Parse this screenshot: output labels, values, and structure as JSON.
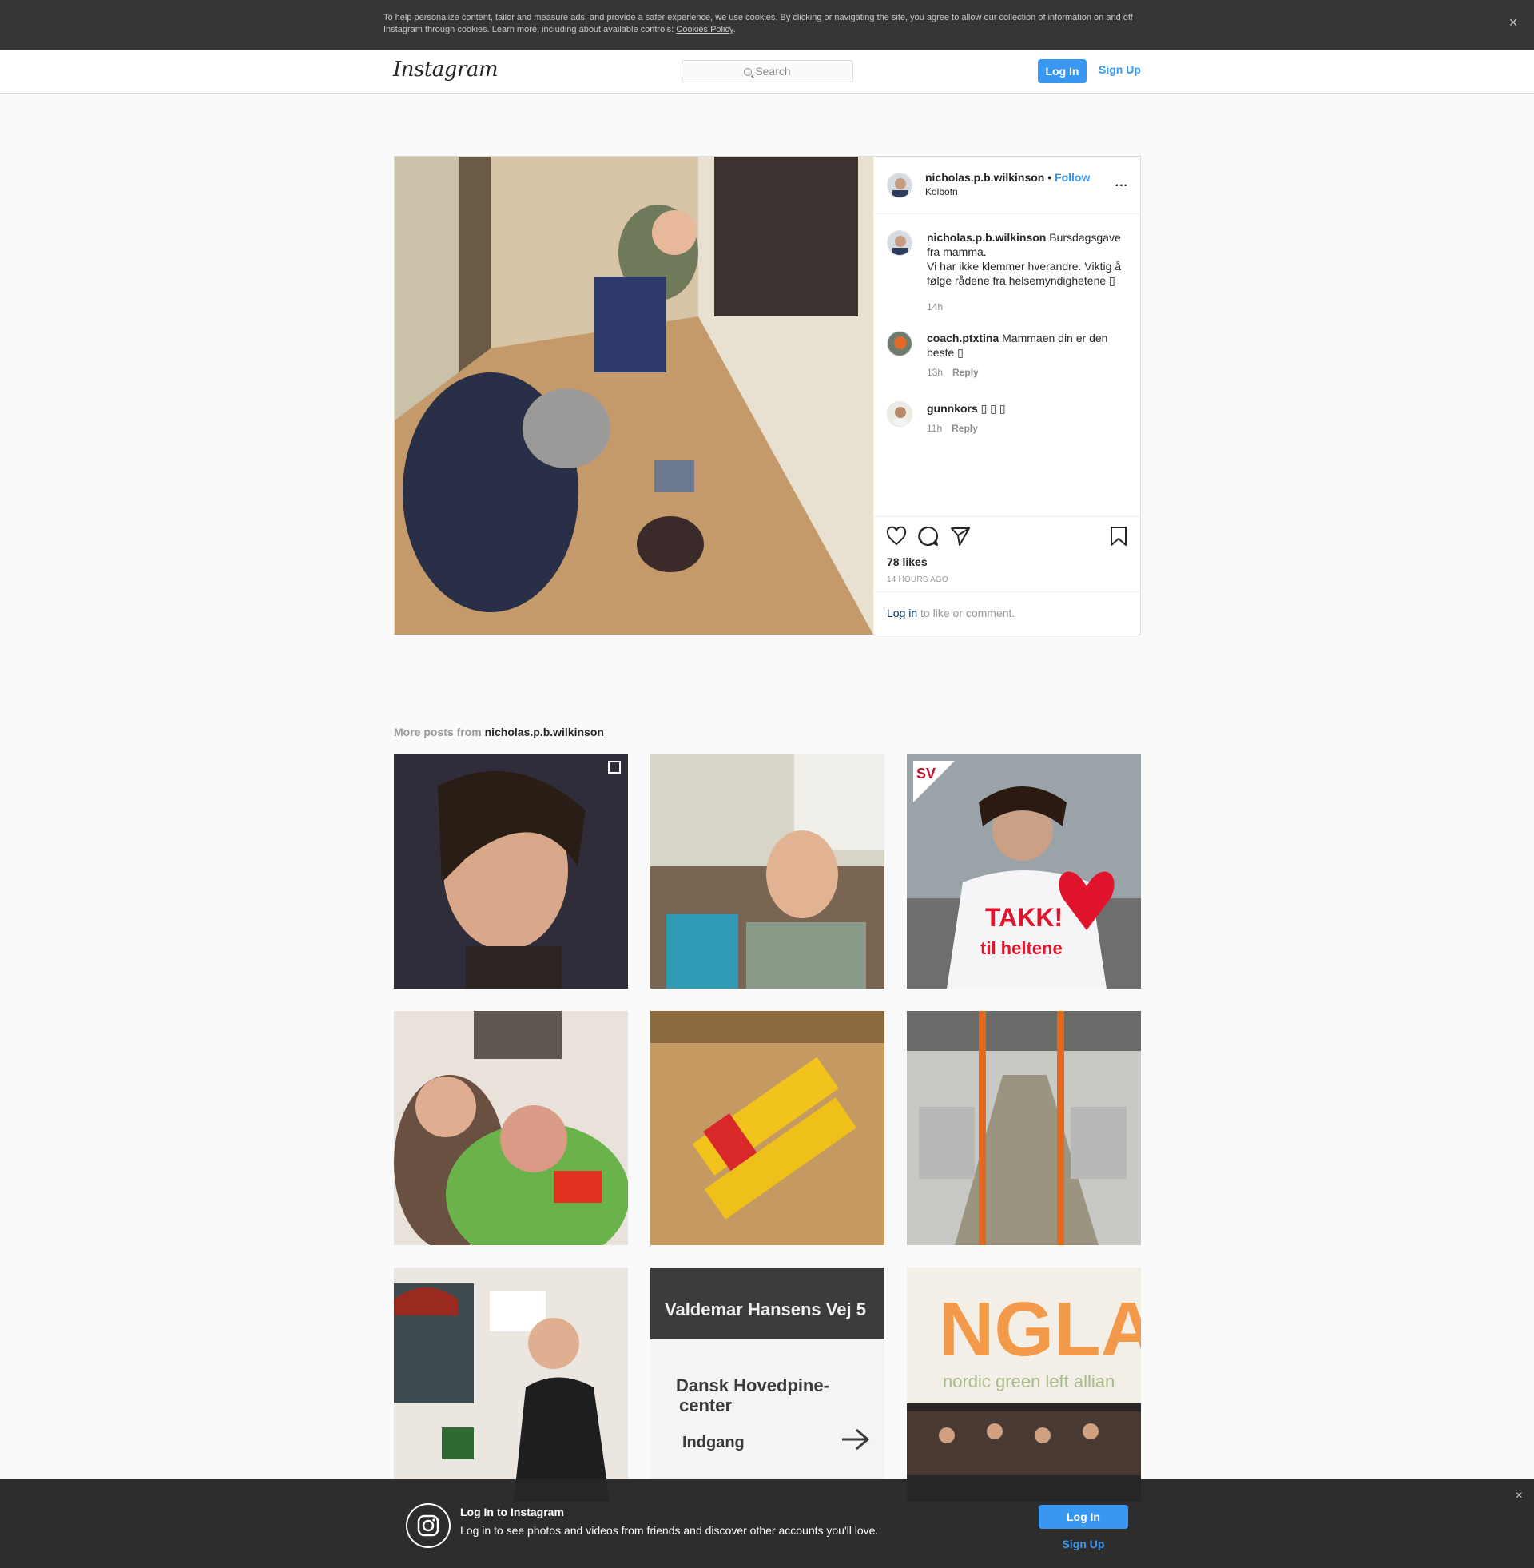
{
  "cookie_banner": {
    "text": "To help personalize content, tailor and measure ads, and provide a safer experience, we use cookies. By clicking or navigating the site, you agree to allow our collection of information on and off Instagram through cookies. Learn more, including about available controls: ",
    "link": "Cookies Policy",
    "end": ".",
    "close": "×"
  },
  "header": {
    "logo": "Instagram",
    "search_placeholder": "Search",
    "login": "Log In",
    "signup": "Sign Up"
  },
  "post": {
    "username": "nicholas.p.b.wilkinson",
    "dot": "•",
    "follow": "Follow",
    "location": "Kolbotn",
    "more": "...",
    "caption": {
      "user": "nicholas.p.b.wilkinson",
      "line1": "Bursdagsgave fra mamma.",
      "line2": "Vi har ikke klemmer hverandre. Viktig å følge rådene fra helsemyndighetene",
      "emoji": "▯",
      "time": "14h"
    },
    "comments": [
      {
        "user": "coach.ptxtina",
        "text": "Mammaen din er den beste",
        "emoji": "▯",
        "time": "13h",
        "reply": "Reply"
      },
      {
        "user": "gunnkors",
        "text": "",
        "emoji": "▯ ▯ ▯",
        "time": "11h",
        "reply": "Reply"
      }
    ],
    "likes": "78 likes",
    "ago": "14 HOURS AGO",
    "login_link": "Log in",
    "login_text": " to like or comment."
  },
  "more_posts": {
    "label": "More posts from ",
    "user": "nicholas.p.b.wilkinson",
    "tile_texts": {
      "takk": "TAKK!",
      "heltene": "til heltene",
      "sv": "SV",
      "street": "Valdemar Hansens Vej 5",
      "sign1": "Dansk Hovedpine-",
      "sign2": "center",
      "sign3": "Indgang",
      "ngla": "NGLA",
      "nordic": "nordic green left allian"
    }
  },
  "bottom_bar": {
    "title": "Log In to Instagram",
    "subtitle": "Log in to see photos and videos from friends and discover other accounts you'll love.",
    "login": "Log In",
    "signup": "Sign Up",
    "close": "×"
  },
  "colors": {
    "accent": "#3897f0",
    "banner": "#363636",
    "border": "#dbdbdb"
  }
}
